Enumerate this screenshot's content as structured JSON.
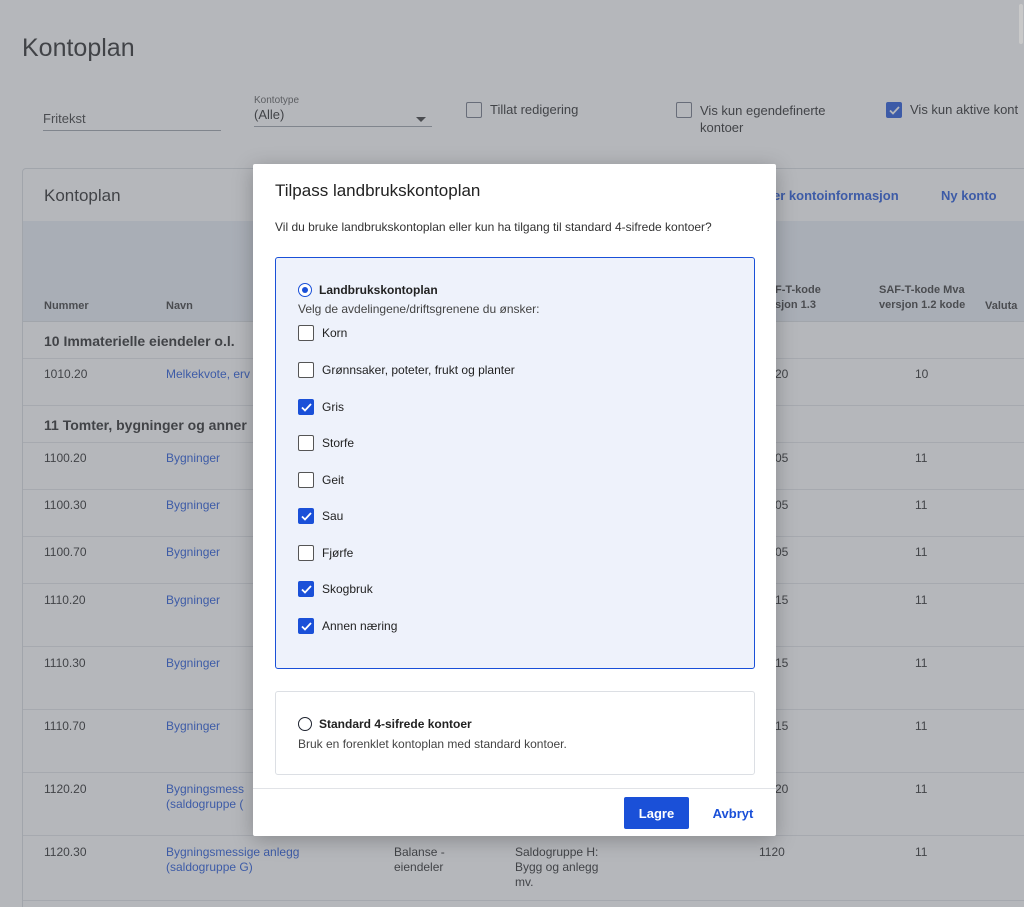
{
  "page": {
    "title": "Kontoplan"
  },
  "filters": {
    "fritekst_placeholder": "Fritekst",
    "kontotype_label": "Kontotype",
    "kontotype_value": "(Alle)",
    "tillat_redigering": "Tillat redigering",
    "vis_egendefinerte_line1": "Vis kun egendefinerte",
    "vis_egendefinerte_line2": "kontoer",
    "vis_aktive": "Vis kun aktive kont"
  },
  "card": {
    "title": "Kontoplan",
    "link_kontoinfo": "er kontoinformasjon",
    "link_ny_konto": "Ny konto"
  },
  "table": {
    "headers": {
      "nummer": "Nummer",
      "navn": "Navn",
      "saft13_line1": "F-T-kode",
      "saft13_line2": "sjon 1.3",
      "saftmva_line1": "SAF-T-kode Mva",
      "saftmva_line2": "versjon 1.2 kode",
      "valuta": "Valuta"
    },
    "groups": [
      "10 Immaterielle eiendeler o.l.",
      "11 Tomter, bygninger og anner"
    ],
    "rows": [
      {
        "nummer": "1010.20",
        "navn": "Melkekvote, erv",
        "saft": "20",
        "mva": "10"
      },
      {
        "nummer": "1100.20",
        "navn": "Bygninger",
        "saft": "05",
        "mva": "11"
      },
      {
        "nummer": "1100.30",
        "navn": "Bygninger",
        "saft": "05",
        "mva": "11"
      },
      {
        "nummer": "1100.70",
        "navn": "Bygninger",
        "saft": "05",
        "mva": "11"
      },
      {
        "nummer": "1110.20",
        "navn": "Bygninger",
        "saft": "15",
        "mva": "11"
      },
      {
        "nummer": "1110.30",
        "navn": "Bygninger",
        "saft": "15",
        "mva": "11"
      },
      {
        "nummer": "1110.70",
        "navn": "Bygninger",
        "saft": "15",
        "mva": "11"
      },
      {
        "nummer": "1120.20",
        "navn_line1": "Bygningsmess",
        "navn_line2": "(saldogruppe (",
        "saft": "20",
        "mva": "11"
      },
      {
        "nummer": "1120.30",
        "navn_line1": "Bygningsmessige anlegg",
        "navn_line2": "(saldogruppe G)",
        "type_line1": "Balanse -",
        "type_line2": "eiendeler",
        "saldo_line1": "Saldogruppe H:",
        "saldo_line2": "Bygg og anlegg",
        "saldo_line3": "mv.",
        "saft": "1120",
        "mva": "11"
      }
    ]
  },
  "modal": {
    "title": "Tilpass landbrukskontoplan",
    "description": "Vil du bruke landbrukskontoplan eller kun ha tilgang til standard 4-sifrede kontoer?",
    "option1": {
      "title": "Landbrukskontoplan",
      "subtitle": "Velg de avdelingene/driftsgrenene du ønsker:",
      "selected": true,
      "items": [
        {
          "label": "Korn",
          "checked": false
        },
        {
          "label": "Grønnsaker, poteter, frukt og planter",
          "checked": false
        },
        {
          "label": "Gris",
          "checked": true
        },
        {
          "label": "Storfe",
          "checked": false
        },
        {
          "label": "Geit",
          "checked": false
        },
        {
          "label": "Sau",
          "checked": true
        },
        {
          "label": "Fjørfe",
          "checked": false
        },
        {
          "label": "Skogbruk",
          "checked": true
        },
        {
          "label": "Annen næring",
          "checked": true
        }
      ]
    },
    "option2": {
      "title": "Standard 4-sifrede kontoer",
      "subtitle": "Bruk en forenklet kontoplan med standard kontoer.",
      "selected": false
    },
    "save_label": "Lagre",
    "cancel_label": "Avbryt"
  },
  "colors": {
    "accent": "#1a50d8",
    "overlay": "#646870"
  },
  "icons": {
    "checkbox_checked": "check-icon",
    "radio": "radio-icon",
    "dropdown": "caret-down-icon"
  }
}
